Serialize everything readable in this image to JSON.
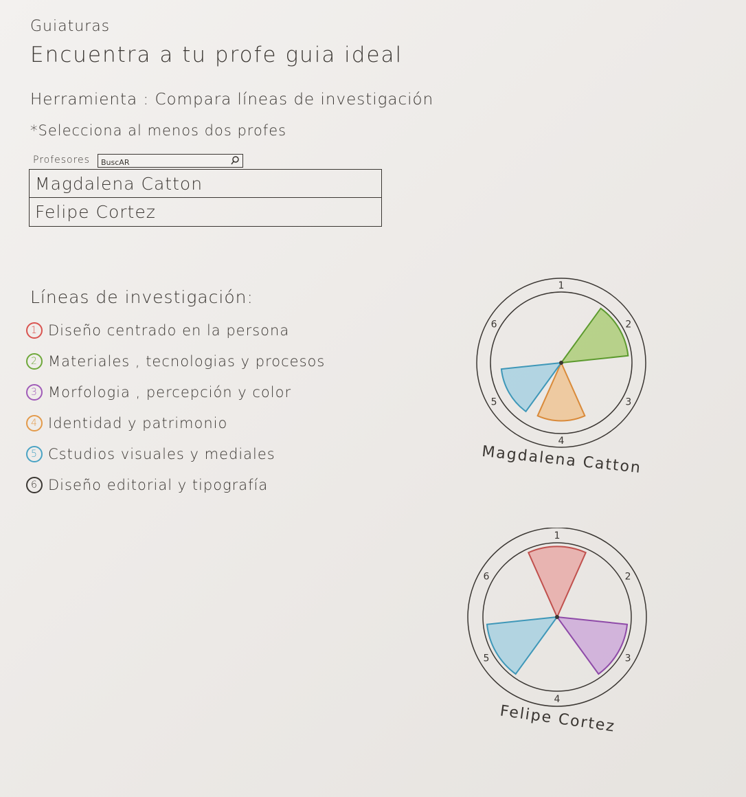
{
  "header": {
    "app_name": "Guiaturas",
    "subtitle": "Encuentra a tu profe guia ideal",
    "tool_title": "Herramienta : Compara líneas de investigación",
    "instruction": "*Selecciona al menos dos profes"
  },
  "professors": {
    "label": "Profesores",
    "search_placeholder": "BuscAR",
    "search_value": "",
    "items": [
      {
        "name": "Magdalena Catton"
      },
      {
        "name": "Felipe Cortez"
      }
    ]
  },
  "research_lines": {
    "title": "Líneas de investigación:",
    "items": [
      {
        "number": "1",
        "label": "Diseño centrado en la persona",
        "color": "#d9534f"
      },
      {
        "number": "2",
        "label": "Materiales , tecnologias y procesos",
        "color": "#6ea83a"
      },
      {
        "number": "3",
        "label": "Morfologia , percepción y color",
        "color": "#a05bb8"
      },
      {
        "number": "4",
        "label": "Identidad y patrimonio",
        "color": "#e39a4a"
      },
      {
        "number": "5",
        "label": "Cstudios visuales y mediales",
        "color": "#4aa3c4"
      },
      {
        "number": "6",
        "label": "Diseño editorial y tipografía",
        "color": "#3a3632"
      }
    ]
  },
  "chart_data": [
    {
      "type": "pie",
      "title": "Magdalena Catton",
      "categories": [
        "1",
        "2",
        "3",
        "4",
        "5",
        "6"
      ],
      "values": [
        0,
        0.95,
        0,
        0.82,
        0.85,
        0
      ],
      "colors": [
        "#e7a3a0",
        "#a5c96b",
        "#c9a3d8",
        "#efc08a",
        "#9fcde0",
        "#999999"
      ],
      "strokes": [
        "#c0504d",
        "#5c9a2e",
        "#8e4aa8",
        "#d98a3a",
        "#3e97b8",
        "#3a3632"
      ]
    },
    {
      "type": "pie",
      "title": "Felipe Cortez",
      "categories": [
        "1",
        "2",
        "3",
        "4",
        "5",
        "6"
      ],
      "values": [
        0.95,
        0,
        0.95,
        0,
        0.95,
        0
      ],
      "colors": [
        "#e7a3a0",
        "#a5c96b",
        "#c9a3d8",
        "#efc08a",
        "#9fcde0",
        "#999999"
      ],
      "strokes": [
        "#c0504d",
        "#5c9a2e",
        "#8e4aa8",
        "#d98a3a",
        "#3e97b8",
        "#3a3632"
      ]
    }
  ]
}
